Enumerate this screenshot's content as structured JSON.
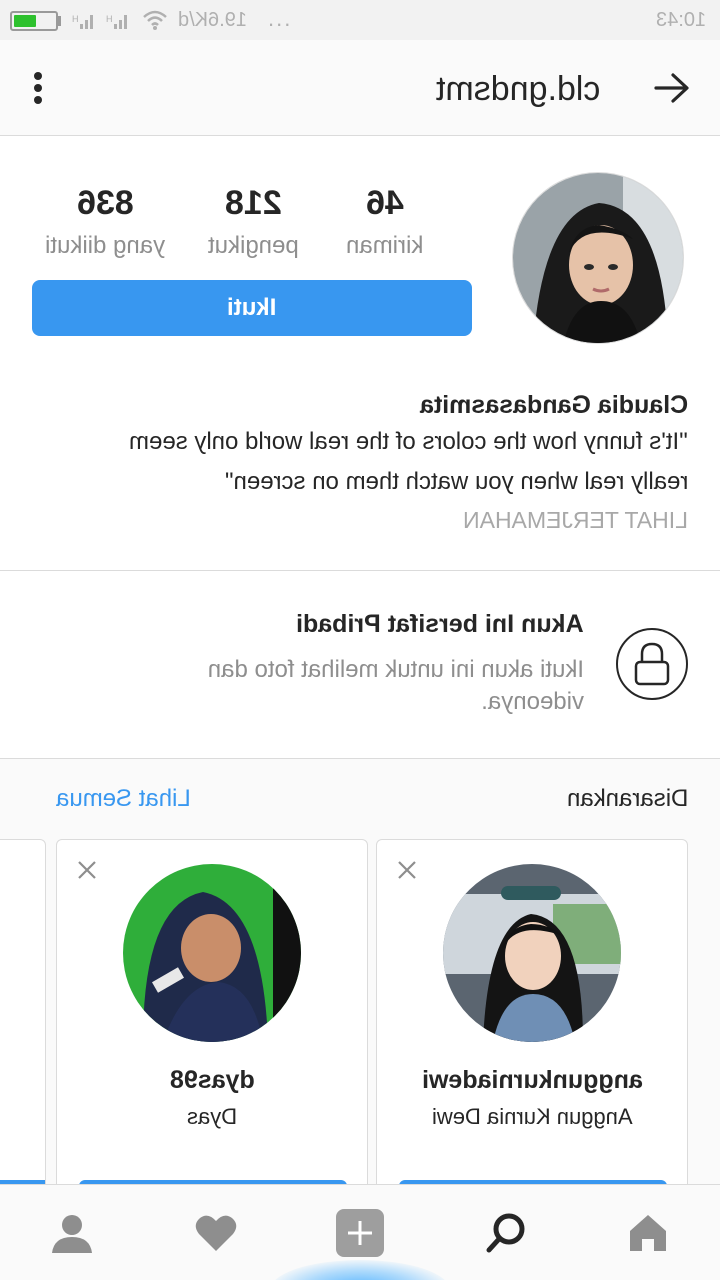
{
  "status_bar": {
    "speed": "19.6K/d",
    "dots": "...",
    "time": "10:43",
    "battery_level": 0.55
  },
  "header": {
    "username": "cld.gndsmt",
    "menu_icon": "more-vertical-icon",
    "back_icon": "arrow-back-icon"
  },
  "profile": {
    "stats": [
      {
        "value": "46",
        "label": "kiriman"
      },
      {
        "value": "218",
        "label": "pengikut"
      },
      {
        "value": "836",
        "label": "yang diikuti"
      }
    ],
    "follow_label": "Ikuti",
    "name": "Claudia Gandasasmita",
    "bio_lines": [
      "\"It's funny how the colors of the real world only seem",
      "really real when you watch them on screen\""
    ],
    "translate_label": "LIHAT TERJEMAHAN"
  },
  "private": {
    "title": "Akun Ini bersifat Pribadi",
    "description": "Ikuti akun ini untuk melihat foto dan videonya."
  },
  "suggestions": {
    "title": "Disarankan",
    "see_all": "Lihat Semua",
    "cards": [
      {
        "username": "anggunkurniadewi",
        "name": "Anggun Kurnia Dewi"
      },
      {
        "username": "dyas98",
        "name": "Dyas"
      }
    ]
  },
  "nav": {
    "items": [
      "home-icon",
      "search-icon",
      "add-icon",
      "heart-icon",
      "profile-icon"
    ]
  },
  "colors": {
    "accent": "#3897f0",
    "text": "#262626",
    "muted": "#8e8e8e",
    "battery": "#2ec12e"
  }
}
